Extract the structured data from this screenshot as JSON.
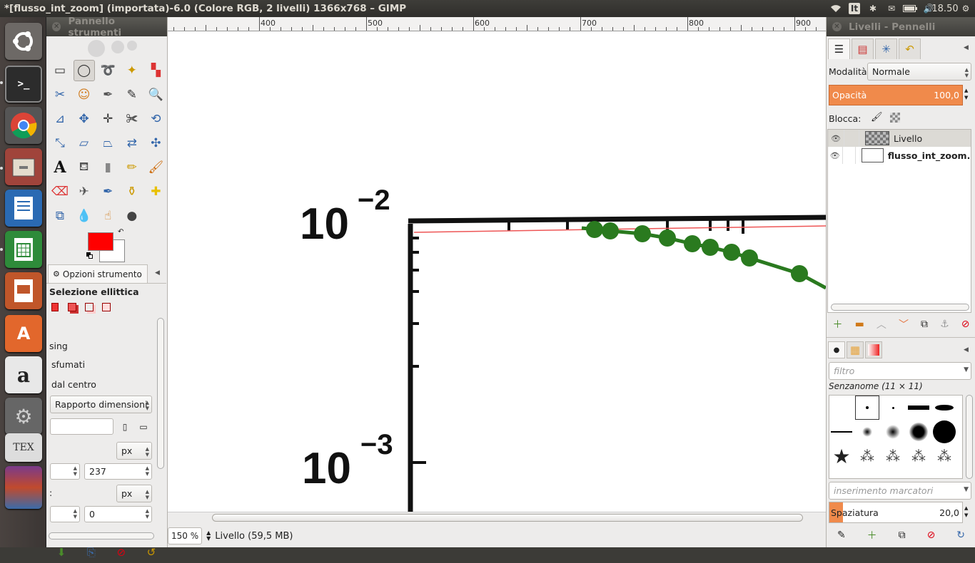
{
  "topbar": {
    "title": "*[flusso_int_zoom] (importata)-6.0 (Colore RGB, 2 livelli) 1366x768 – GIMP",
    "keyboard": "It",
    "clock": "18.50"
  },
  "launcher": {
    "icons": [
      "ubuntu-dash",
      "terminal",
      "chrome",
      "files",
      "writer",
      "calc",
      "impress",
      "software-center",
      "amazon",
      "system-settings",
      "texmaker",
      "workspace-switcher"
    ]
  },
  "toolbox": {
    "header": "Pannello strumenti",
    "options_tab": "Opzioni strumento",
    "tool_title": "Selezione ellittica",
    "label_antialias": "sing",
    "label_feather": "sfumati",
    "label_center": "dal centro",
    "fixed_combo": "Rapporto dimensioni",
    "unit1": "px",
    "unit2": "px",
    "size_value": "237",
    "label_colon": ":",
    "pos_value": "0"
  },
  "canvas": {
    "ruler_labels": [
      "400",
      "500",
      "600",
      "700",
      "800",
      "900"
    ],
    "zoom": "150 %",
    "status": "Livello (59,5 MB)",
    "plot_labels": {
      "top_exp_base": "10",
      "top_exp": "−2",
      "bottom_exp_base": "10",
      "bottom_exp": "−3"
    }
  },
  "right": {
    "header": "Livelli - Pennelli",
    "mode_label": "Modalità:",
    "mode_value": "Normale",
    "opacity_label": "Opacità",
    "opacity_value": "100,0",
    "lock_label": "Blocca:",
    "layers": [
      {
        "name": "Livello",
        "selected": true
      },
      {
        "name": "flusso_int_zoom.pr",
        "selected": false
      }
    ],
    "brush_filter_placeholder": "filtro",
    "brush_name": "Senzanome (11 × 11)",
    "tag_placeholder": "inserimento marcatori",
    "spacing_label": "Spaziatura",
    "spacing_value": "20,0"
  },
  "colors": {
    "fg": "#ff0000",
    "bg": "#ffffff",
    "accent": "#f08a4b",
    "curve": "#2a7a1f"
  }
}
